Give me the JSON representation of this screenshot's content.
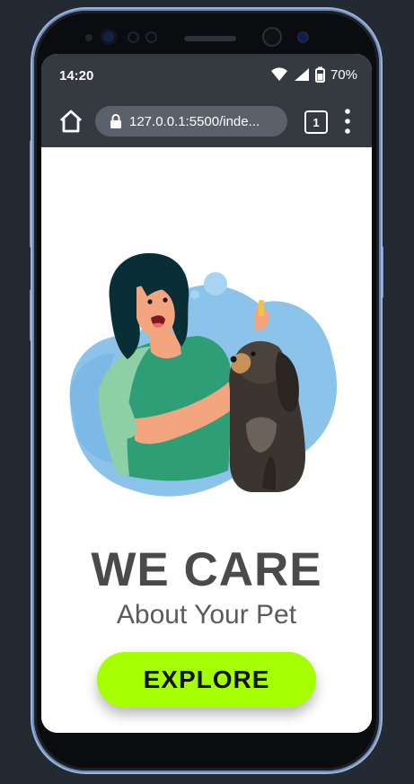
{
  "status_bar": {
    "time": "14:20",
    "battery_percent": "70%",
    "icons": [
      "wifi-icon",
      "signal-icon",
      "battery-icon"
    ]
  },
  "browser": {
    "url": "127.0.0.1:5500/inde...",
    "tabs_count": "1",
    "icons": [
      "home-icon",
      "lock-icon",
      "tabs-icon",
      "more-vert-icon"
    ]
  },
  "hero": {
    "title": "WE CARE",
    "subtitle": "About Your Pet",
    "button_label": "EXPLORE"
  },
  "colors": {
    "status_bg": "#343a40",
    "url_bg": "#5a616a",
    "button_bg": "#a6ff00",
    "title_text": "#4a4a4a",
    "blob_blue": "#8cc3ea"
  }
}
